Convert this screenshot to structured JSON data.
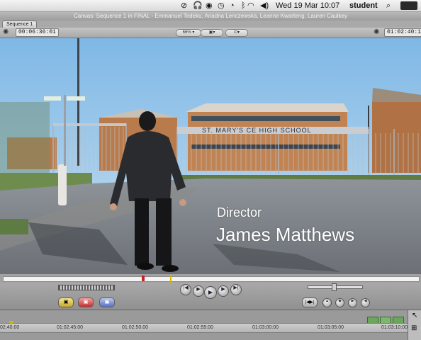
{
  "menubar": {
    "datetime": "Wed 19 Mar  10:07",
    "user": "student"
  },
  "window": {
    "title": "Canvas: Sequence 1 in FINAL - Emmanuel Tedeku, Ariadna Lenczewska, Leanne Kwarteng, Lauren Caulkey"
  },
  "tabs": [
    {
      "label": "Sequence 1"
    }
  ],
  "toolbar": {
    "duration_timecode": "00:06:36:01",
    "zoom": "66%",
    "current_timecode": "01:02:40:11"
  },
  "frame": {
    "school_sign": "ST. MARY'S CE      HIGH SCHOOL",
    "caption_role": "Director",
    "caption_name": "James Matthews"
  },
  "timeline": {
    "ruler_labels": [
      "01:02:45:00",
      "01:02:50:00",
      "01:02:55:00",
      "01:03:00:00",
      "01:03:05:00",
      "01:03:10:00"
    ],
    "left_label": "02:40:00"
  },
  "colors": {
    "sky": "#9fc9e8",
    "mark_in": "#cc1f1f",
    "playhead": "#d6b400"
  }
}
